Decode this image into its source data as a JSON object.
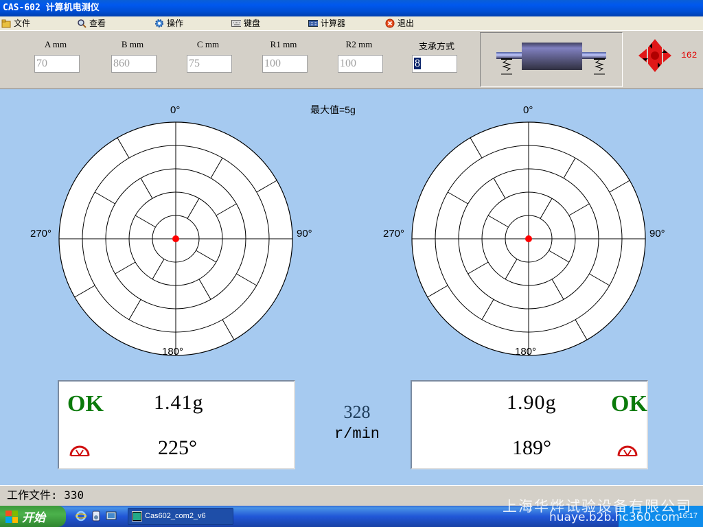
{
  "window": {
    "title": "CAS-602 计算机电测仪"
  },
  "menu": {
    "items": [
      {
        "label": "文件",
        "icon": "folder-icon"
      },
      {
        "label": "查看",
        "icon": "magnifier-icon"
      },
      {
        "label": "操作",
        "icon": "gear-icon"
      },
      {
        "label": "键盘",
        "icon": "keyboard-icon"
      },
      {
        "label": "计算器",
        "icon": "calculator-icon"
      },
      {
        "label": "退出",
        "icon": "exit-icon"
      }
    ]
  },
  "params": {
    "a": {
      "label": "A mm",
      "value": "70"
    },
    "b": {
      "label": "B mm",
      "value": "860"
    },
    "c": {
      "label": "C mm",
      "value": "75"
    },
    "r1": {
      "label": "R1 mm",
      "value": "100"
    },
    "r2": {
      "label": "R2 mm",
      "value": "100"
    },
    "support": {
      "label": "支承方式",
      "value": "8"
    }
  },
  "header_speed": "162",
  "polar": {
    "max_label": "最大值=5g",
    "angles": {
      "top": "0°",
      "right": "90°",
      "bottom": "180°",
      "left": "270°"
    }
  },
  "left_result": {
    "status": "OK",
    "magnitude": "1.41g",
    "angle": "225°"
  },
  "right_result": {
    "status": "OK",
    "magnitude": "1.90g",
    "angle": "189°"
  },
  "rpm": {
    "value": "328",
    "unit": "r/min"
  },
  "status": {
    "work_file": "工作文件: 330"
  },
  "taskbar": {
    "start_label": "开始",
    "task_label": "Cas602_com2_v6",
    "clock": "16:17"
  },
  "watermark": {
    "line1": "上海华烨试验设备有限公司",
    "line2": "huaye.b2b.hc360.com"
  },
  "colors": {
    "background": "#a6caf0",
    "ok": "#0a7a0a",
    "marker": "#ff0000",
    "accent_red": "#e00000"
  }
}
